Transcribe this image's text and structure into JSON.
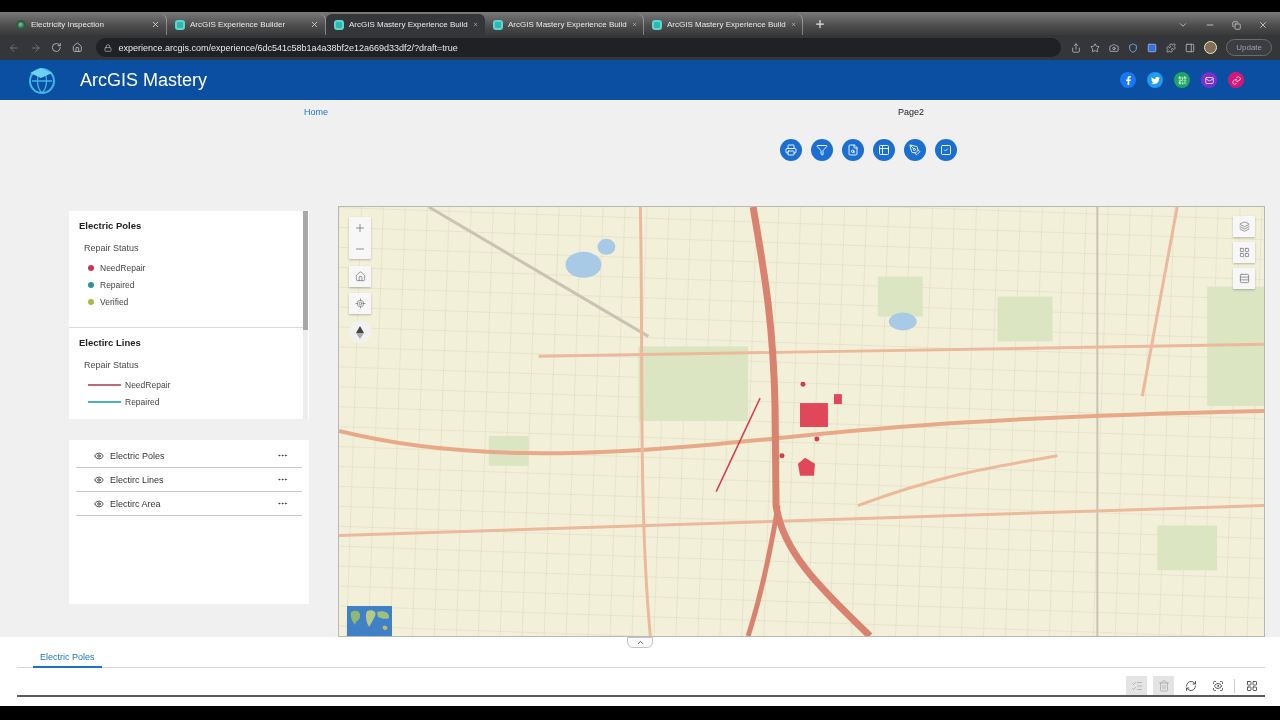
{
  "browser": {
    "tabs": [
      {
        "title": "Electricity Inspection",
        "selected": false
      },
      {
        "title": "ArcGIS Experience Builder",
        "selected": false
      },
      {
        "title": "ArcGIS Mastery Experience Build",
        "selected": true
      },
      {
        "title": "ArcGIS Mastery Experience Build",
        "selected": false
      },
      {
        "title": "ArcGIS Mastery Experience Build",
        "selected": false
      }
    ],
    "url": "experience.arcgis.com/experience/6dc541c58b1a4a38bf2e12a669d33df2/?draft=true",
    "update_button": "Update"
  },
  "header": {
    "title": "ArcGIS Mastery"
  },
  "nav": [
    {
      "label": "Home",
      "selected": true
    },
    {
      "label": "Page2",
      "selected": false
    }
  ],
  "legend": [
    {
      "title": "Electric Poles",
      "field": "Repair Status",
      "kind": "point",
      "items": [
        {
          "label": "NeedRepair",
          "color": "#c23b55"
        },
        {
          "label": "Repaired",
          "color": "#2f8fa5"
        },
        {
          "label": "Verified",
          "color": "#a8b94a"
        }
      ]
    },
    {
      "title": "Electirc Lines",
      "field": "Repair Status",
      "kind": "line",
      "items": [
        {
          "label": "NeedRepair",
          "color": "#c06a78"
        },
        {
          "label": "Repaired",
          "color": "#4ab0c0"
        }
      ]
    }
  ],
  "layers": [
    {
      "name": "Electric Poles",
      "visible": true
    },
    {
      "name": "Electirc Lines",
      "visible": true
    },
    {
      "name": "Electirc Area",
      "visible": true
    }
  ],
  "attribute_table": {
    "tabs": [
      {
        "label": "Electric Poles",
        "selected": true
      }
    ],
    "actions": [
      {
        "disabled": true
      },
      {
        "disabled": true
      },
      {
        "disabled": false
      },
      {
        "disabled": false
      },
      {
        "disabled": false
      }
    ]
  }
}
